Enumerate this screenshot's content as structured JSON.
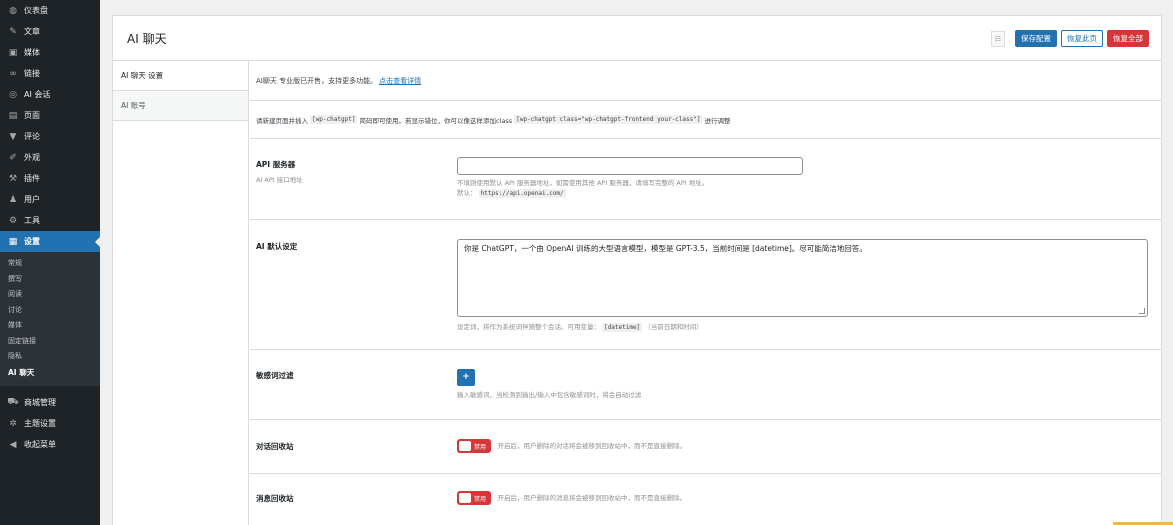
{
  "sidebar": {
    "top_items": [
      {
        "icon": "dashboard-icon",
        "glyph": "◍",
        "label": "仪表盘"
      },
      {
        "icon": "pin-icon",
        "glyph": "✎",
        "label": "文章"
      },
      {
        "icon": "media-icon",
        "glyph": "▣",
        "label": "媒体"
      },
      {
        "icon": "link-icon",
        "glyph": "∞",
        "label": "链接"
      },
      {
        "icon": "chat-icon",
        "glyph": "◎",
        "label": "AI 会话"
      },
      {
        "icon": "page-icon",
        "glyph": "▤",
        "label": "页面"
      },
      {
        "icon": "comment-icon",
        "glyph": "▼",
        "label": "评论"
      },
      {
        "icon": "appearance-icon",
        "glyph": "✐",
        "label": "外观"
      },
      {
        "icon": "plugin-icon",
        "glyph": "⚒",
        "label": "插件"
      },
      {
        "icon": "users-icon",
        "glyph": "♟",
        "label": "用户"
      },
      {
        "icon": "tools-icon",
        "glyph": "⚙",
        "label": "工具"
      },
      {
        "icon": "settings-icon",
        "glyph": "▦",
        "label": "设置"
      }
    ],
    "submenu": [
      "常规",
      "撰写",
      "阅读",
      "讨论",
      "媒体",
      "固定链接",
      "隐私",
      "AI 聊天"
    ],
    "bottom_items": [
      {
        "icon": "store-icon",
        "glyph": "⛟",
        "label": "商城管理"
      },
      {
        "icon": "theme-icon",
        "glyph": "✲",
        "label": "主题设置"
      },
      {
        "icon": "collapse-icon",
        "glyph": "◀",
        "label": "收起菜单"
      }
    ]
  },
  "header": {
    "title": "AI 聊天",
    "grid_glyph": "☷",
    "save_label": "保存配置",
    "reset_page_label": "恢复此页",
    "reset_all_label": "恢复全部"
  },
  "tabs": [
    "AI 聊天 设置",
    "AI 账号"
  ],
  "notice": {
    "text": "AI聊天 专业版已开售，支持更多功能。",
    "link": "点击查看详情"
  },
  "shortcode": {
    "prefix": "请新建页面并插入",
    "code1": "[wp-chatgpt]",
    "middle": "简码即可使用。若显示错位，你可以像这样添加class",
    "code2": "[wp-chatgpt class=\"wp-chatgpt-frontend your-class\"]",
    "suffix": "进行调整"
  },
  "api_server": {
    "label": "API 服务器",
    "sub": "AI API 接口地址",
    "value": "",
    "desc": "不填则使用默认 API 服务器地址，如需使用其他 API 服务器，请填写完整的 API 地址。",
    "default_prefix": "默认：",
    "default_value": "https://api.openai.com/"
  },
  "ai_default": {
    "label": "AI 默认设定",
    "value": "你是 ChatGPT，一个由 OpenAI 训练的大型语言模型，模型是 GPT-3.5，当前时间是 [datetime]。尽可能简洁地回答。",
    "desc_prefix": "设定词，将作为系统词伴随整个会话。可用变量：",
    "desc_code": "[datetime]",
    "desc_suffix": "（当前日期和时间）"
  },
  "sensitive": {
    "label": "敏感词过滤",
    "add_glyph": "+",
    "desc": "输入敏感词，当检测到输出/输入中包含敏感词时，将会自动过滤"
  },
  "chat_recycle": {
    "label": "对话回收站",
    "toggle_label": "禁用",
    "desc": "开启后，用户删除的对话将会被移到回收站中，而不是直接删除。"
  },
  "msg_recycle": {
    "label": "消息回收站",
    "toggle_label": "禁用",
    "desc": "开启后，用户删除的消息将会被移到回收站中，而不是直接删除。"
  }
}
